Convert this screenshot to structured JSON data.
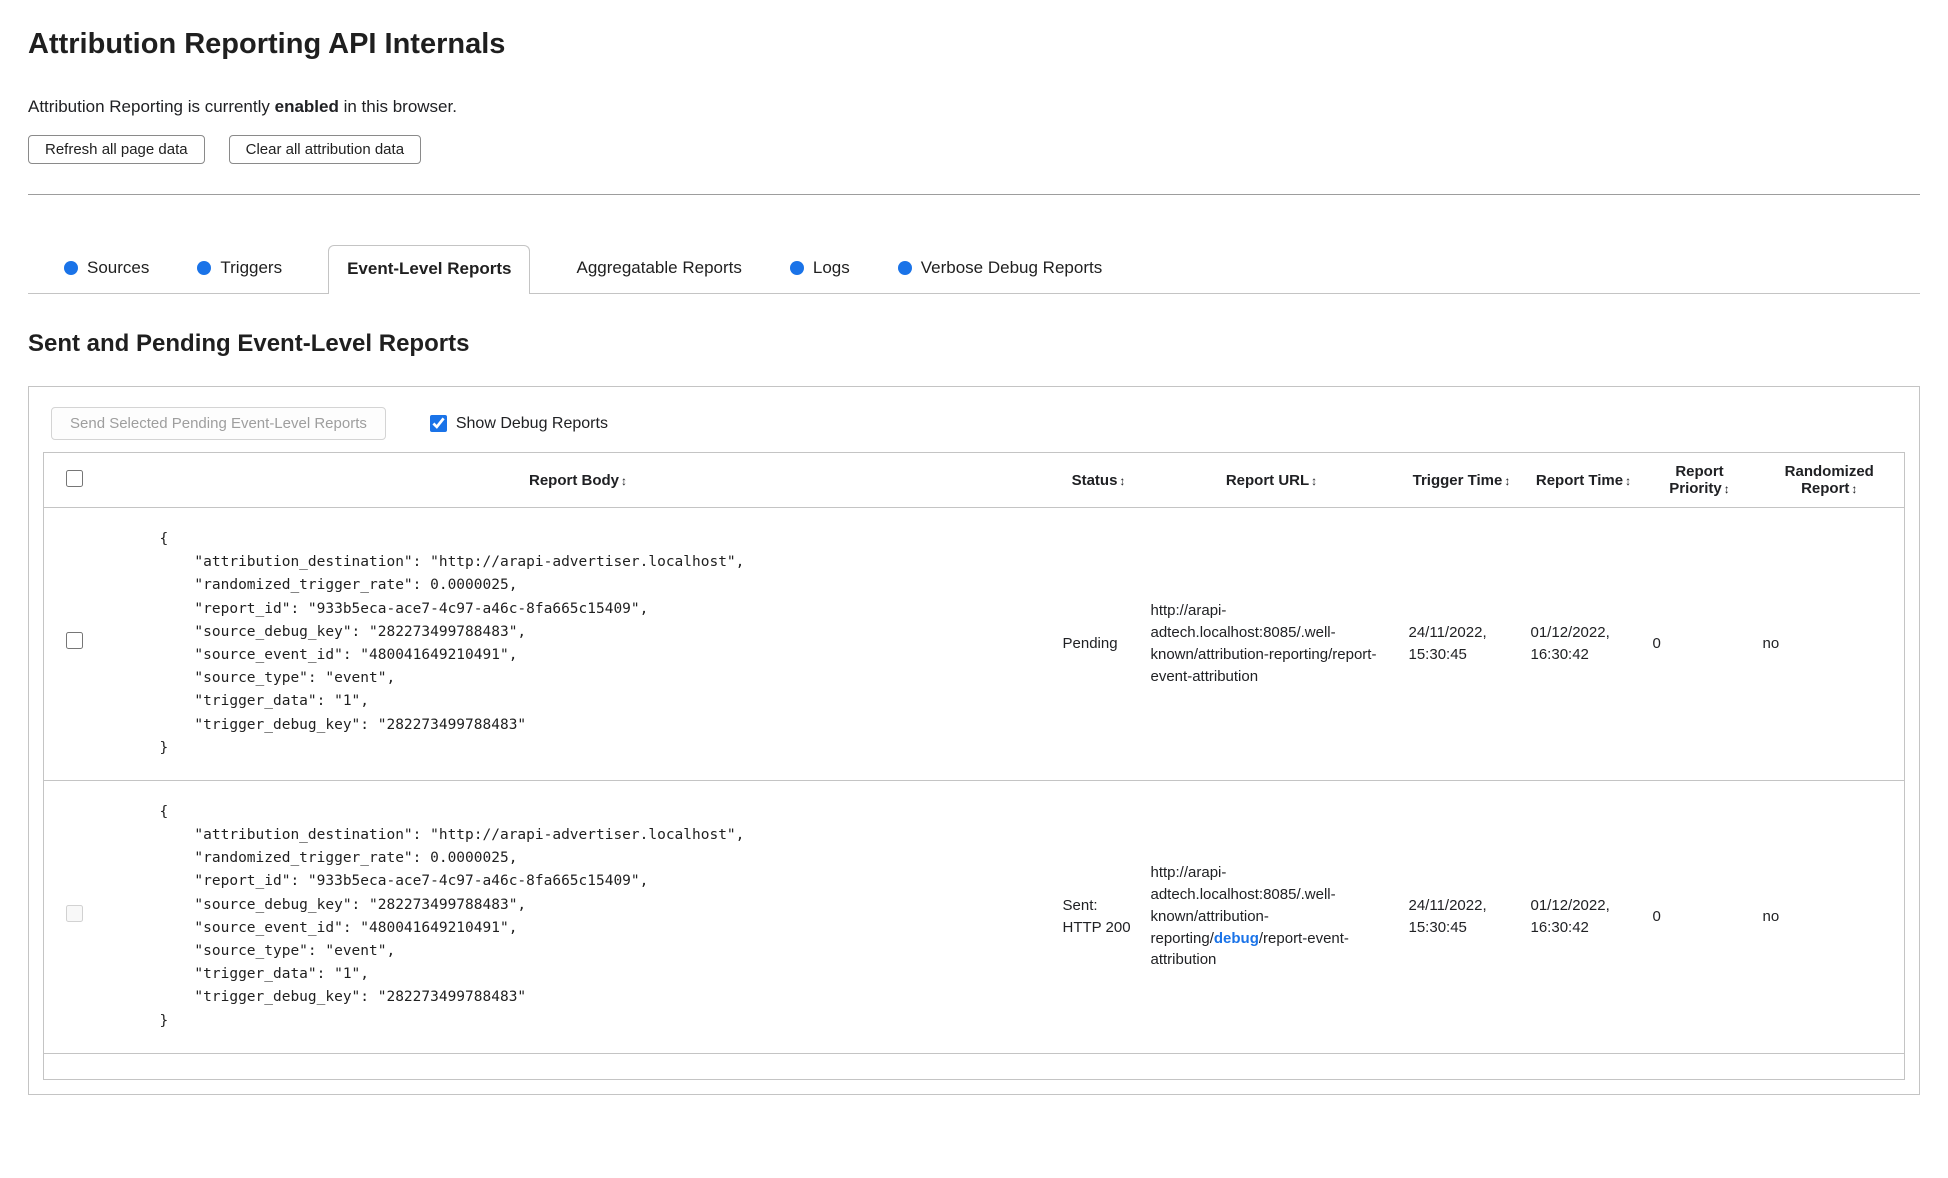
{
  "colors": {
    "accent_blue": "#1a73e8",
    "border_gray": "#c4c4c4"
  },
  "page": {
    "title": "Attribution Reporting API Internals",
    "status_prefix": "Attribution Reporting is currently ",
    "status_bold": "enabled",
    "status_suffix": " in this browser.",
    "refresh_button": "Refresh all page data",
    "clear_button": "Clear all attribution data"
  },
  "tabs": [
    {
      "label": "Sources",
      "has_dot": true,
      "active": false
    },
    {
      "label": "Triggers",
      "has_dot": true,
      "active": false
    },
    {
      "label": "Event-Level Reports",
      "has_dot": false,
      "active": true
    },
    {
      "label": "Aggregatable Reports",
      "has_dot": false,
      "active": false
    },
    {
      "label": "Logs",
      "has_dot": true,
      "active": false
    },
    {
      "label": "Verbose Debug Reports",
      "has_dot": true,
      "active": false
    }
  ],
  "section": {
    "heading": "Sent and Pending Event-Level Reports",
    "send_button": "Send Selected Pending Event-Level Reports",
    "show_debug_label": "Show Debug Reports",
    "show_debug_checked": true
  },
  "table": {
    "sort_icon": "↕",
    "headers": [
      "Report Body",
      "Status",
      "Report URL",
      "Trigger Time",
      "Report Time",
      "Report Priority",
      "Randomized Report"
    ],
    "rows": [
      {
        "report_body": "{\n    \"attribution_destination\": \"http://arapi-advertiser.localhost\",\n    \"randomized_trigger_rate\": 0.0000025,\n    \"report_id\": \"933b5eca-ace7-4c97-a46c-8fa665c15409\",\n    \"source_debug_key\": \"282273499788483\",\n    \"source_event_id\": \"480041649210491\",\n    \"source_type\": \"event\",\n    \"trigger_data\": \"1\",\n    \"trigger_debug_key\": \"282273499788483\"\n}",
        "status": "Pending",
        "url_pre": "http://arapi-adtech.localhost:8085/.well-known/attribution-reporting/report-event-attribution",
        "url_debug": "",
        "url_post": "",
        "trigger_time": "24/11/2022, 15:30:45",
        "report_time": "01/12/2022, 16:30:42",
        "report_priority": "0",
        "randomized_report": "no",
        "selectable": true
      },
      {
        "report_body": "{\n    \"attribution_destination\": \"http://arapi-advertiser.localhost\",\n    \"randomized_trigger_rate\": 0.0000025,\n    \"report_id\": \"933b5eca-ace7-4c97-a46c-8fa665c15409\",\n    \"source_debug_key\": \"282273499788483\",\n    \"source_event_id\": \"480041649210491\",\n    \"source_type\": \"event\",\n    \"trigger_data\": \"1\",\n    \"trigger_debug_key\": \"282273499788483\"\n}",
        "status": "Sent: HTTP 200",
        "url_pre": "http://arapi-adtech.localhost:8085/.well-known/attribution-reporting/",
        "url_debug": "debug",
        "url_post": "/report-event-attribution",
        "trigger_time": "24/11/2022, 15:30:45",
        "report_time": "01/12/2022, 16:30:42",
        "report_priority": "0",
        "randomized_report": "no",
        "selectable": false
      }
    ]
  }
}
